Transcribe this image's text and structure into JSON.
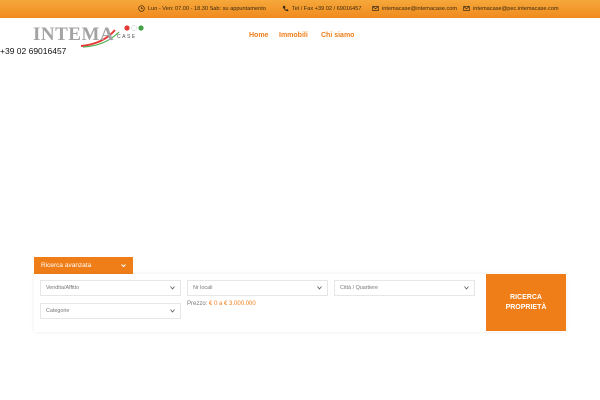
{
  "topbar": {
    "hours": "Lun - Ven: 07.00 - 18.30 Sab: su appuntamento",
    "phone": "Tel / Fax +39 02 / 69016457",
    "email": "intemacase@intemacase.com",
    "pec": "intemacase@pec.intemacase.com",
    "icons": [
      "clock-icon",
      "phone-icon",
      "mail-icon",
      "mail-icon"
    ]
  },
  "logo": {
    "text": "INTEMA",
    "sub": "CASE"
  },
  "phone_floating": "+39 02 69016457",
  "nav": {
    "items": [
      {
        "label": "Home",
        "color": "#f07e18"
      },
      {
        "label": "Immobili",
        "color": "#f07e18"
      },
      {
        "label": "Chi siamo",
        "color": "#f07e18"
      }
    ]
  },
  "search": {
    "tab_label": "Ricerca avanzata",
    "fields": {
      "type": "Vendita/Affitto",
      "rooms": "Nr locali",
      "city": "Città / Quartiere",
      "category": "Categorie"
    },
    "price_label": "Prezzo:",
    "price_range": "€ 0 a € 3.000.000",
    "button_label": "RICERCA PROPRIETÀ"
  },
  "colors": {
    "accent": "#f07e18",
    "topbar": "#f39a2c"
  }
}
